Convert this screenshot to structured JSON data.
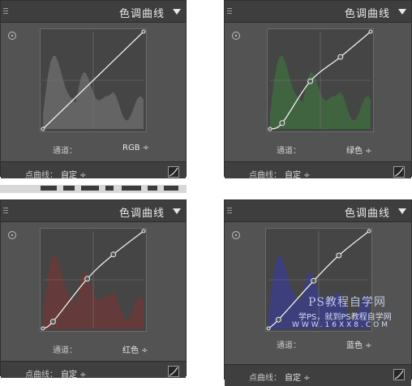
{
  "panels": [
    {
      "title": "色调曲线",
      "channel_label": "通道：",
      "channel_value": "RGB ÷",
      "point_curve_label": "点曲线：",
      "point_curve_value": "自定 ÷",
      "hist_color": "#6a6a6a",
      "curve_points": [
        [
          0,
          0
        ],
        [
          1,
          1
        ]
      ]
    },
    {
      "title": "色调曲线",
      "channel_label": "通道：",
      "channel_value": "绿色 ÷",
      "point_curve_label": "点曲线：",
      "point_curve_value": "自定 ÷",
      "hist_color": "#3f6a3f",
      "curve_points": [
        [
          0,
          0
        ],
        [
          0.12,
          0.06
        ],
        [
          0.4,
          0.49
        ],
        [
          0.7,
          0.74
        ],
        [
          1,
          1
        ]
      ]
    },
    {
      "title": "色调曲线",
      "channel_label": "通道：",
      "channel_value": "红色 ÷",
      "point_curve_label": "点曲线：",
      "point_curve_value": "自定 ÷",
      "hist_color": "#6a3838",
      "curve_points": [
        [
          0,
          0
        ],
        [
          0.1,
          0.07
        ],
        [
          0.44,
          0.51
        ],
        [
          0.7,
          0.76
        ],
        [
          1,
          1
        ]
      ]
    },
    {
      "title": "色调曲线",
      "channel_label": "通道：",
      "channel_value": "蓝色 ÷",
      "point_curve_label": "点曲线：",
      "point_curve_value": "自定 ÷",
      "hist_color": "#3b3e86",
      "curve_points": [
        [
          0,
          0
        ],
        [
          0.1,
          0.09
        ],
        [
          0.45,
          0.49
        ],
        [
          0.7,
          0.75
        ],
        [
          1,
          1
        ]
      ]
    }
  ],
  "watermark": {
    "line1": "PS教程自学网",
    "line2": "学PS，就到PS教程自学网",
    "line3": "WWW.16XX8.COM"
  }
}
